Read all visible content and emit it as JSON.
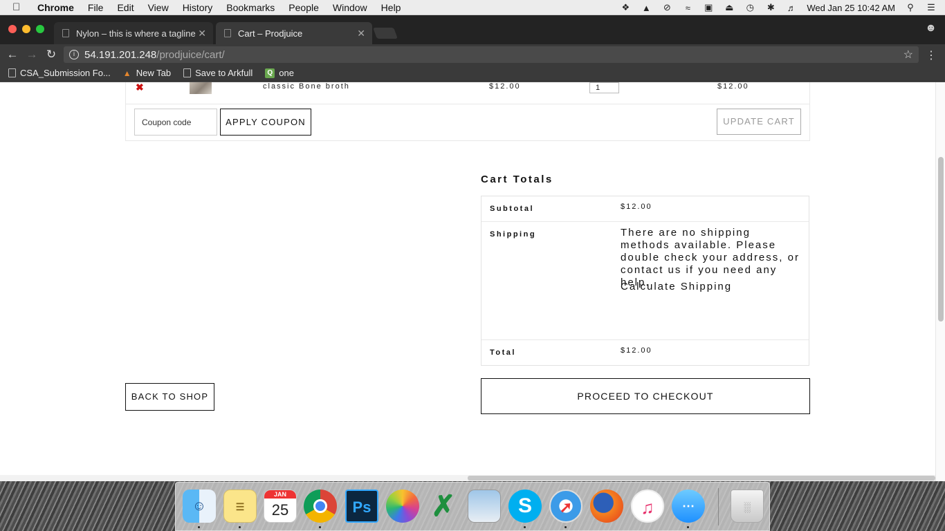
{
  "menubar": {
    "app_name": "Chrome",
    "menus": [
      "File",
      "Edit",
      "View",
      "History",
      "Bookmarks",
      "People",
      "Window",
      "Help"
    ],
    "clock": "Wed Jan 25  10:42 AM"
  },
  "browser": {
    "tabs": [
      {
        "title": "Nylon – this is where a tagline"
      },
      {
        "title": "Cart – Prodjuice"
      }
    ],
    "url_host": "54.191.201.248",
    "url_path": "/prodjuice/cart/",
    "bookmarks": [
      {
        "label": "CSA_Submission Fo...",
        "icon": "page-icon"
      },
      {
        "label": "New Tab",
        "icon": "flame-icon"
      },
      {
        "label": "Save to Arkfull",
        "icon": "page-icon"
      },
      {
        "label": "one",
        "icon": "q-icon"
      }
    ]
  },
  "cart": {
    "item": {
      "remove_glyph": "✖",
      "name": "classic Bone broth",
      "price": "$12.00",
      "quantity": "1",
      "subtotal": "$12.00"
    },
    "coupon_placeholder": "Coupon code",
    "apply_coupon_label": "APPLY COUPON",
    "update_cart_label": "UPDATE CART"
  },
  "totals": {
    "title": "Cart Totals",
    "subtotal_label": "Subtotal",
    "subtotal_value": "$12.00",
    "shipping_label": "Shipping",
    "shipping_message": "There are no shipping methods available. Please double check your address, or contact us if you need any help.",
    "calculate_shipping": "Calculate Shipping",
    "total_label": "Total",
    "total_value": "$12.00"
  },
  "actions": {
    "back_to_shop": "BACK TO SHOP",
    "proceed_to_checkout": "PROCEED TO CHECKOUT"
  },
  "dock": {
    "calendar_month": "JAN",
    "calendar_day": "25",
    "apps": [
      "finder",
      "notes",
      "calendar",
      "chrome",
      "photoshop",
      "photos",
      "excel",
      "preview",
      "skype",
      "safari",
      "firefox",
      "itunes",
      "messages",
      "trash"
    ]
  }
}
